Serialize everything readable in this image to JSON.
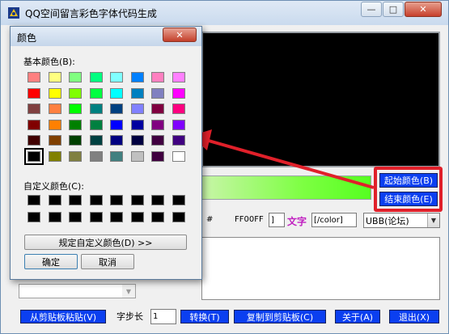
{
  "window": {
    "title": "QQ空间留言彩色字体代码生成",
    "min_symbol": "—",
    "max_symbol": "□",
    "close_symbol": "✕"
  },
  "gradient": {
    "start_button": "起始颜色(B)",
    "end_button": "结束颜色(E)"
  },
  "code_row": {
    "hash": "#",
    "start_hex": "FF00FF",
    "open_bracket": "]",
    "sample_text": "文字",
    "close_tag": "[/color]",
    "format_value": "UBB(论坛)",
    "dropdown_symbol": "▼"
  },
  "bottom": {
    "paste_button": "从剪贴板粘贴(V)",
    "step_label": "字步长",
    "step_value": "1",
    "convert_button": "转换(T)",
    "copy_button": "复制到剪贴板(C)",
    "about_button": "关于(A)",
    "exit_button": "退出(X)"
  },
  "color_dialog": {
    "title": "颜色",
    "close_symbol": "✕",
    "basic_colors_label": "基本颜色(B):",
    "custom_colors_label": "自定义颜色(C):",
    "define_custom_button": "规定自定义颜色(D) >>",
    "ok_button": "确定",
    "cancel_button": "取消",
    "basic_colors": [
      [
        "#ff8080",
        "#ffff80",
        "#80ff80",
        "#00ff80",
        "#80ffff",
        "#0080ff",
        "#ff80c0",
        "#ff80ff"
      ],
      [
        "#ff0000",
        "#ffff00",
        "#80ff00",
        "#00ff40",
        "#00ffff",
        "#0080c0",
        "#8080c0",
        "#ff00ff"
      ],
      [
        "#804040",
        "#ff8040",
        "#00ff00",
        "#008080",
        "#004080",
        "#8080ff",
        "#800040",
        "#ff0080"
      ],
      [
        "#800000",
        "#ff8000",
        "#008000",
        "#008040",
        "#0000ff",
        "#0000a0",
        "#800080",
        "#8000ff"
      ],
      [
        "#400000",
        "#804000",
        "#004000",
        "#004040",
        "#000080",
        "#000040",
        "#400040",
        "#400080"
      ],
      [
        "#000000",
        "#808000",
        "#808040",
        "#808080",
        "#408080",
        "#c0c0c0",
        "#400040",
        "#ffffff"
      ]
    ],
    "selected_color": "#000000",
    "custom_colors": [
      [
        "#000000",
        "#000000",
        "#000000",
        "#000000",
        "#000000",
        "#000000",
        "#000000",
        "#000000"
      ],
      [
        "#000000",
        "#000000",
        "#000000",
        "#000000",
        "#000000",
        "#000000",
        "#000000",
        "#000000"
      ]
    ]
  },
  "colors": {
    "preview_bg": "#000000",
    "button_blue": "#0b3ff0",
    "highlight_red": "#e0202a",
    "gradient_start": "#c8f5a8",
    "gradient_end": "#55ff20"
  }
}
